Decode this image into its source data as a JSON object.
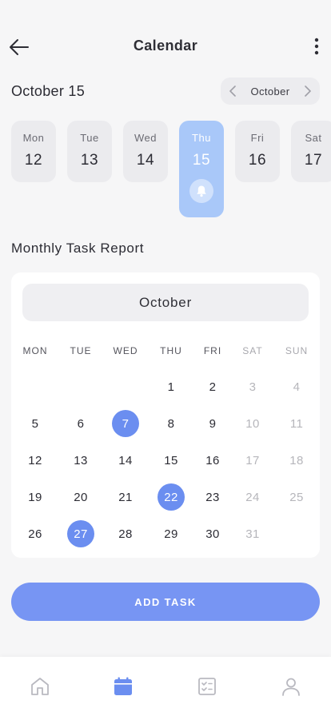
{
  "header": {
    "title": "Calendar"
  },
  "selected_date_label": "October 15",
  "month_switcher": {
    "label": "October"
  },
  "week_days": [
    {
      "name": "Mon",
      "num": "12"
    },
    {
      "name": "Tue",
      "num": "13"
    },
    {
      "name": "Wed",
      "num": "14"
    },
    {
      "name": "Thu",
      "num": "15"
    },
    {
      "name": "Fri",
      "num": "16"
    },
    {
      "name": "Sat",
      "num": "17"
    }
  ],
  "section_title": "Monthly Task Report",
  "calendar": {
    "month": "October",
    "weekdays": [
      "MON",
      "TUE",
      "WED",
      "THU",
      "FRI",
      "SAT",
      "SUN"
    ],
    "weeks": [
      [
        "",
        "",
        "",
        "1",
        "2",
        "3",
        "4"
      ],
      [
        "5",
        "6",
        "7",
        "8",
        "9",
        "10",
        "11"
      ],
      [
        "12",
        "13",
        "14",
        "15",
        "16",
        "17",
        "18"
      ],
      [
        "19",
        "20",
        "21",
        "22",
        "23",
        "24",
        "25"
      ],
      [
        "26",
        "27",
        "28",
        "29",
        "30",
        "31",
        ""
      ]
    ],
    "task_days": [
      "7",
      "22",
      "27"
    ]
  },
  "add_task_label": "ADD TASK",
  "colors": {
    "accent": "#7795f3",
    "task_day": "#6b8ef0",
    "active_day": "#a9c8f9",
    "icon_active": "#6b8ef0",
    "icon_inactive": "#b9b9c0"
  },
  "tabbar": {
    "items": [
      {
        "icon": "home-icon",
        "active": false
      },
      {
        "icon": "calendar-icon",
        "active": true
      },
      {
        "icon": "checklist-icon",
        "active": false
      },
      {
        "icon": "profile-icon",
        "active": false
      }
    ]
  }
}
